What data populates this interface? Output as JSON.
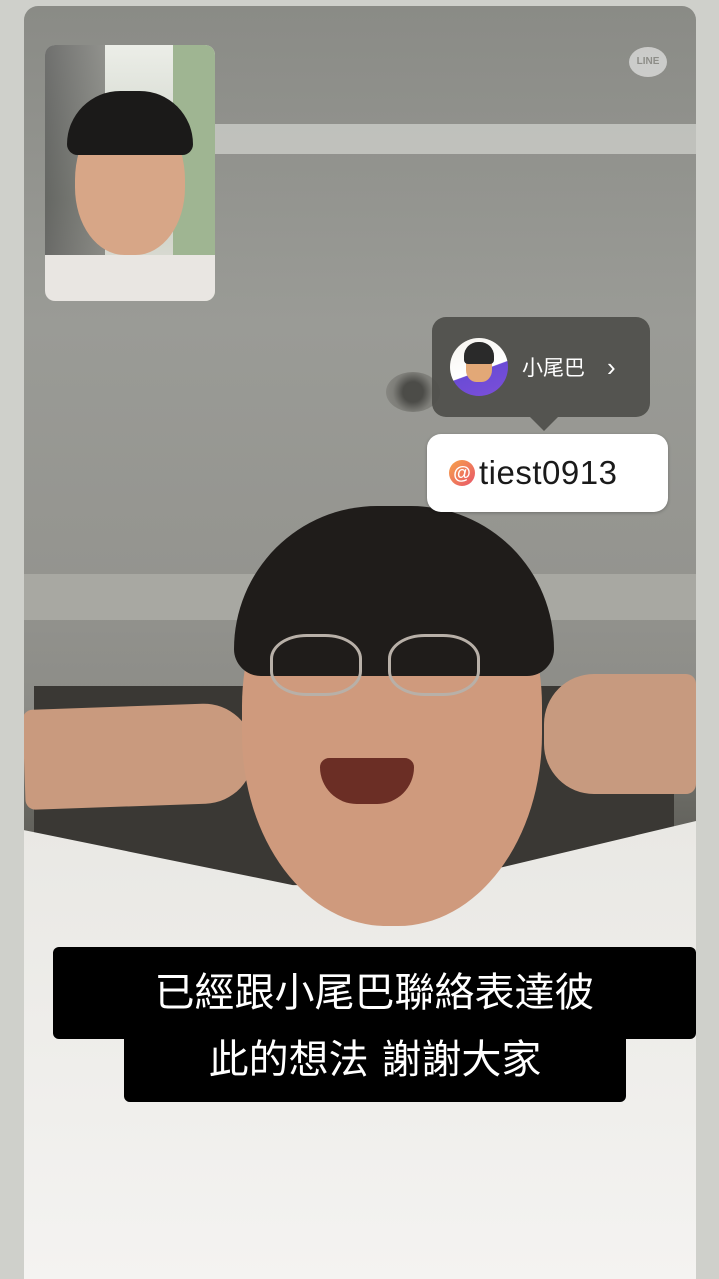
{
  "app": "LINE",
  "pip": {
    "alt": "self view camera"
  },
  "line_logo": "LINE",
  "user_tag": {
    "name": "小尾巴",
    "chevron": "›",
    "icon": "avatar"
  },
  "threads_sticker": {
    "icon": "threads-icon",
    "glyph": "@",
    "handle": "tiest0913"
  },
  "caption": {
    "line1": "已經跟小尾巴聯絡表達彼",
    "line2": "此的想法  謝謝大家"
  },
  "colors": {
    "caption_bg": "#000000",
    "caption_text": "#ffffff",
    "chip_bg": "#4e4e4a",
    "pill_bg": "#ffffff"
  }
}
